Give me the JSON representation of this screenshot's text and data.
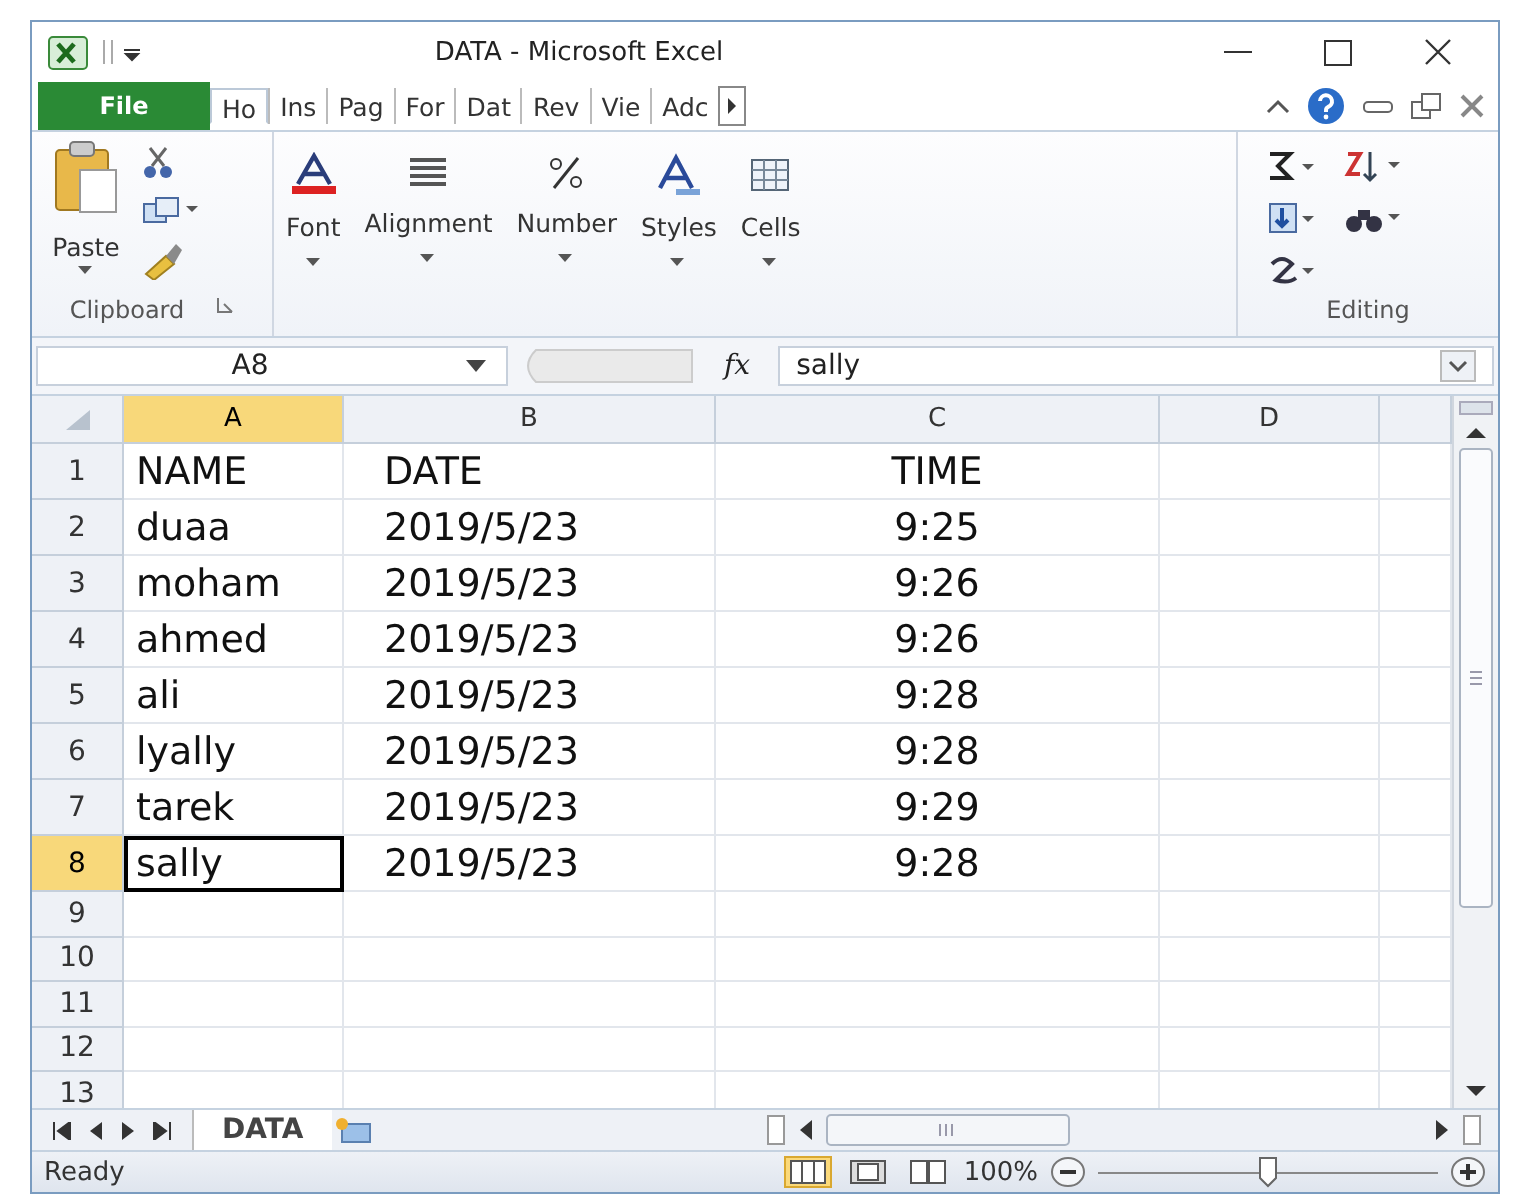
{
  "window": {
    "title": "DATA  -  Microsoft Excel"
  },
  "ribbon": {
    "file_tab": "File",
    "tabs": [
      {
        "label": "Ho",
        "selected": true
      },
      {
        "label": "Ins",
        "selected": false
      },
      {
        "label": "Pag",
        "selected": false
      },
      {
        "label": "For",
        "selected": false
      },
      {
        "label": "Dat",
        "selected": false
      },
      {
        "label": "Rev",
        "selected": false
      },
      {
        "label": "Vie",
        "selected": false
      },
      {
        "label": "Adc",
        "selected": false
      }
    ],
    "groups": [
      {
        "kind": "clipboard",
        "buttons": [
          "Paste"
        ],
        "label": "Clipboard"
      },
      {
        "kind": "button",
        "buttons": [
          "Font"
        ]
      },
      {
        "kind": "button",
        "buttons": [
          "Alignment"
        ]
      },
      {
        "kind": "button",
        "buttons": [
          "Number"
        ]
      },
      {
        "kind": "button",
        "buttons": [
          "Styles"
        ]
      },
      {
        "kind": "button",
        "buttons": [
          "Cells"
        ]
      },
      {
        "kind": "editing",
        "label": "Editing"
      }
    ]
  },
  "formula_bar": {
    "name_box": "A8",
    "fx": "fx",
    "value": "sally"
  },
  "sheet": {
    "columns": [
      {
        "label": "A",
        "selected": true
      },
      {
        "label": "B",
        "selected": false
      },
      {
        "label": "C",
        "selected": false
      },
      {
        "label": "D",
        "selected": false
      }
    ],
    "rows": [
      {
        "header": "1",
        "cells": [
          "NAME",
          "DATE",
          "TIME"
        ],
        "selected": false
      },
      {
        "header": "2",
        "cells": [
          "duaa",
          "2019/5/23",
          "9:25"
        ],
        "selected": false
      },
      {
        "header": "3",
        "cells": [
          "moham",
          "2019/5/23",
          "9:26"
        ],
        "selected": false
      },
      {
        "header": "4",
        "cells": [
          "ahmed",
          "2019/5/23",
          "9:26"
        ],
        "selected": false
      },
      {
        "header": "5",
        "cells": [
          "ali",
          "2019/5/23",
          "9:28"
        ],
        "selected": false
      },
      {
        "header": "6",
        "cells": [
          "lyally",
          "2019/5/23",
          "9:28"
        ],
        "selected": false
      },
      {
        "header": "7",
        "cells": [
          "tarek",
          "2019/5/23",
          "9:29"
        ],
        "selected": false
      },
      {
        "header": "8",
        "cells": [
          "sally",
          "2019/5/23",
          "9:28"
        ],
        "selected": true
      },
      {
        "header": "9",
        "selected": false
      },
      {
        "header": "10",
        "selected": false
      },
      {
        "header": "11",
        "selected": false
      },
      {
        "header": "12",
        "selected": false
      },
      {
        "header": "13",
        "selected": false
      }
    ]
  },
  "sheet_tabs": [
    {
      "label": "DATA",
      "selected": true
    }
  ],
  "status_bar": {
    "status": "Ready",
    "zoom": "100%",
    "zoom_slider": {
      "level": 0.5
    }
  }
}
